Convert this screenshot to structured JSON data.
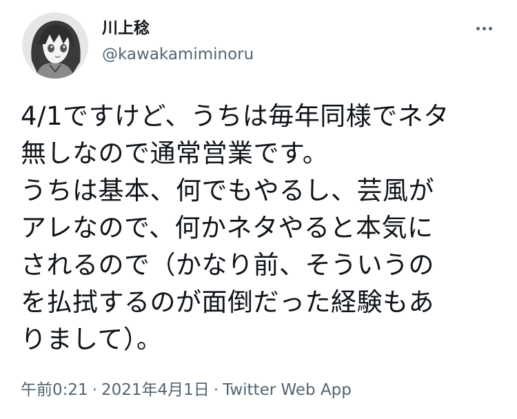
{
  "author": {
    "display_name": "川上稔",
    "handle": "@kawakamiminoru",
    "avatar_icon": "anime-character-avatar-icon"
  },
  "more_icon": "more-horizontal-icon",
  "tweet": {
    "lines": [
      "4/1ですけど、うちは毎年同様でネタ",
      "無しなので通常営業です。",
      "うちは基本、何でもやるし、芸風が",
      "アレなので、何かネタやると本気に",
      "されるので（かなり前、そういうの",
      "を払拭するのが面倒だった経験もあ",
      "りまして）。"
    ]
  },
  "meta": {
    "time": "午前0:21",
    "separator": "·",
    "date": "2021年4月1日",
    "source": "Twitter Web App"
  },
  "colors": {
    "text_primary": "#0f1419",
    "text_secondary": "#536471",
    "background": "#ffffff"
  }
}
